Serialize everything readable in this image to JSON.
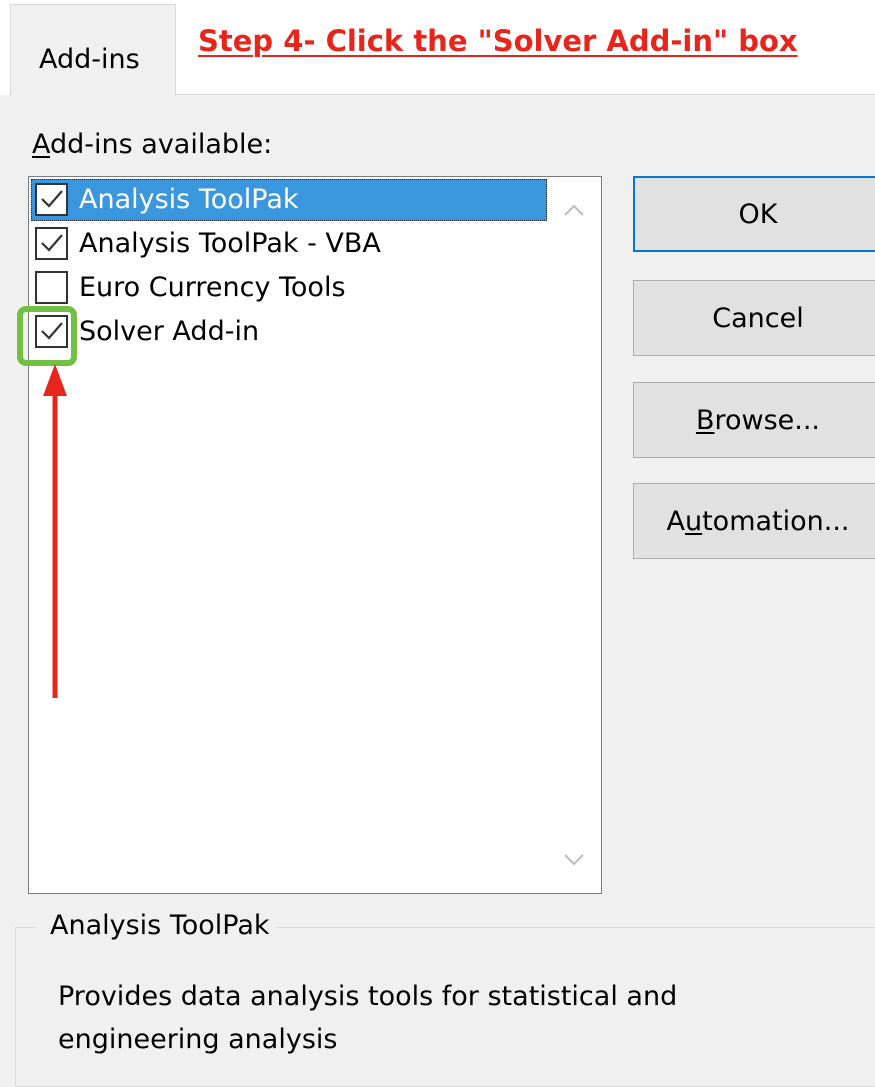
{
  "dialog": {
    "tab_label": "Add-ins",
    "annotation": "Step 4- Click the \"Solver Add-in\" box"
  },
  "addins": {
    "label_accel": "A",
    "label_rest": "dd-ins available:",
    "items": [
      {
        "label": "Analysis ToolPak",
        "checked": true,
        "selected": true
      },
      {
        "label": "Analysis ToolPak - VBA",
        "checked": true,
        "selected": false
      },
      {
        "label": "Euro Currency Tools",
        "checked": false,
        "selected": false
      },
      {
        "label": "Solver Add-in",
        "checked": true,
        "selected": false
      }
    ]
  },
  "buttons": {
    "ok": "OK",
    "cancel": "Cancel",
    "browse_accel": "B",
    "browse_rest": "rowse...",
    "automation_pre": "A",
    "automation_accel": "u",
    "automation_rest": "tomation..."
  },
  "description": {
    "title": "Analysis ToolPak",
    "text": "Provides data analysis tools for statistical and engineering analysis"
  },
  "colors": {
    "selection": "#3a96dd",
    "annotation": "#e8251b",
    "highlight": "#70c044",
    "default_button_border": "#0078d7"
  },
  "icons": {
    "checkmark": "check-icon",
    "scroll_up": "chevron-up-icon",
    "scroll_down": "chevron-down-icon",
    "arrow": "red-arrow-up-icon"
  }
}
